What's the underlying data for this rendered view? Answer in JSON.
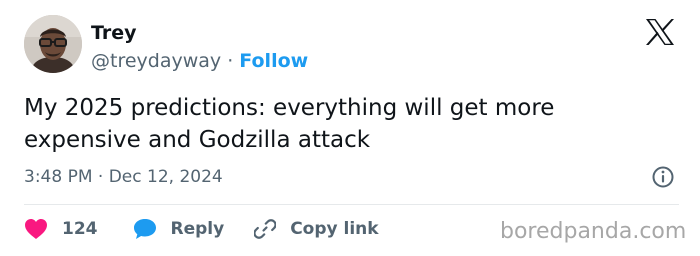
{
  "author": {
    "display_name": "Trey",
    "handle": "@treydayway",
    "separator": "·",
    "follow_label": "Follow"
  },
  "tweet": {
    "text": "My 2025 predictions: everything will get more expensive and Godzilla attack",
    "time": "3:48 PM",
    "date_separator": "·",
    "date": "Dec 12, 2024"
  },
  "actions": {
    "like_count": "124",
    "reply_label": "Reply",
    "copy_link_label": "Copy link"
  },
  "watermark": "boredpanda.com",
  "icons": {
    "platform": "x-logo-icon",
    "info": "info-icon",
    "like": "heart-icon",
    "reply": "speech-bubble-icon",
    "copy_link": "link-icon"
  },
  "colors": {
    "text": "#0f1419",
    "secondary": "#536471",
    "follow": "#1d9bf0",
    "heart": "#f91880",
    "reply": "#1d9bf0",
    "watermark": "#a7a7a7"
  }
}
